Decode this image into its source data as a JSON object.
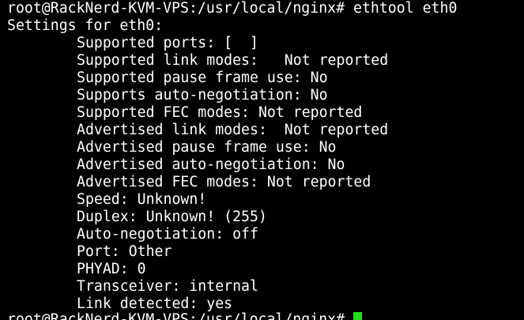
{
  "terminal": {
    "command_line": "root@RackNerd-KVM-VPS:/usr/local/nginx# ethtool eth0",
    "header": "Settings for eth0:",
    "settings": [
      "Supported ports: [  ]",
      "Supported link modes:   Not reported",
      "Supported pause frame use: No",
      "Supports auto-negotiation: No",
      "Supported FEC modes: Not reported",
      "Advertised link modes:  Not reported",
      "Advertised pause frame use: No",
      "Advertised auto-negotiation: No",
      "Advertised FEC modes: Not reported",
      "Speed: Unknown!",
      "Duplex: Unknown! (255)",
      "Auto-negotiation: off",
      "Port: Other",
      "PHYAD: 0",
      "Transceiver: internal",
      "Link detected: yes"
    ],
    "prompt": "root@RackNerd-KVM-VPS:/usr/local/nginx# ",
    "colors": {
      "background": "#000000",
      "text": "#ffffff",
      "cursor": "#22dd22"
    }
  }
}
